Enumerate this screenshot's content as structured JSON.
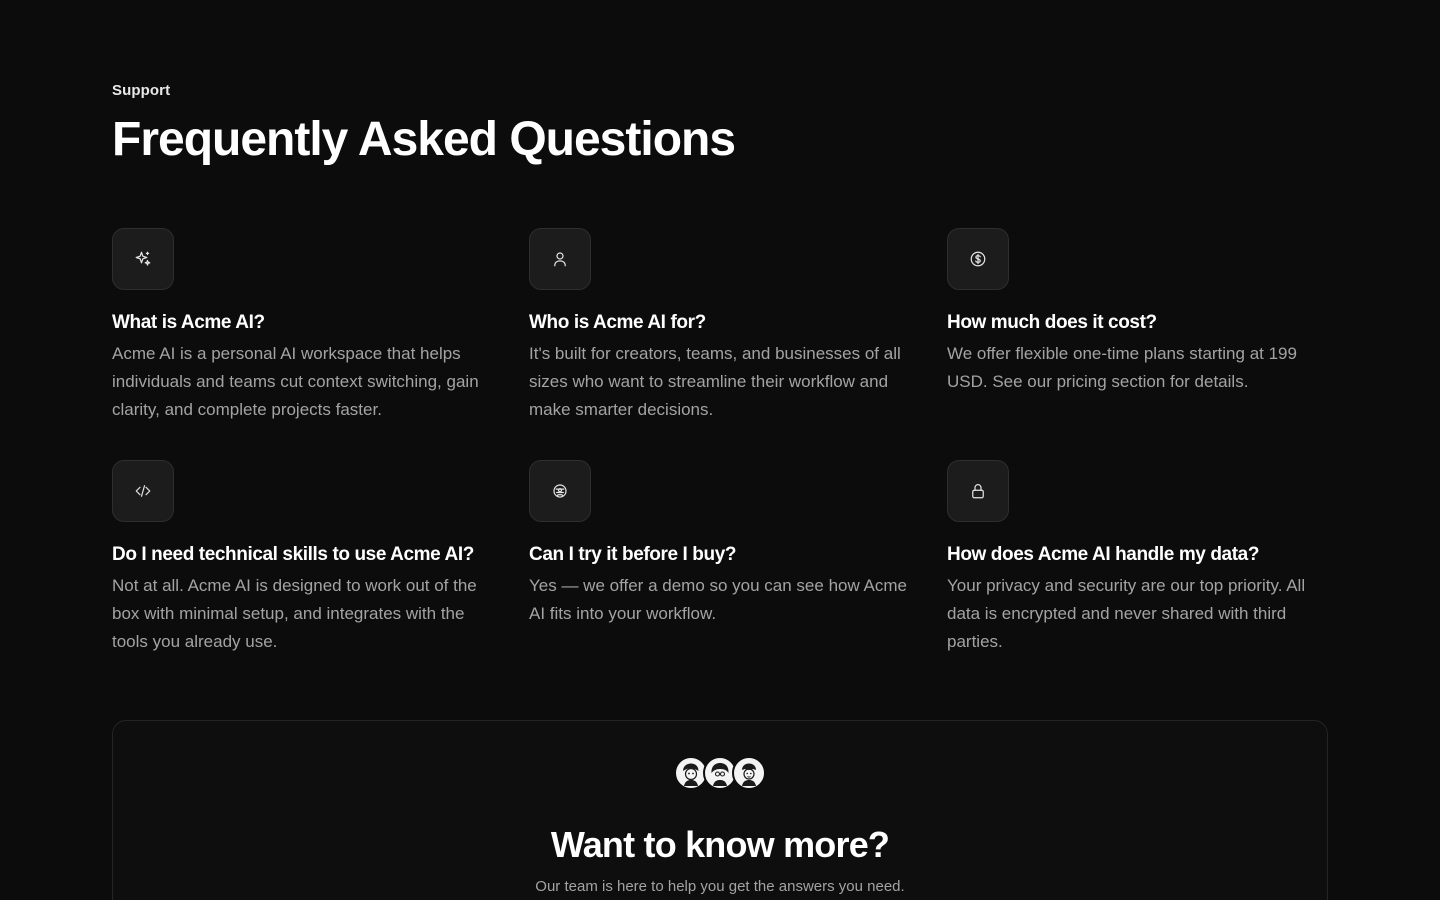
{
  "header": {
    "eyebrow": "Support",
    "title": "Frequently Asked Questions"
  },
  "faqs": [
    {
      "icon": "sparkles-icon",
      "question": "What is Acme AI?",
      "answer": "Acme AI is a personal AI workspace that helps individuals and teams cut context switching, gain clarity, and complete projects faster."
    },
    {
      "icon": "user-icon",
      "question": "Who is Acme AI for?",
      "answer": "It's built for creators, teams, and businesses of all sizes who want to streamline their workflow and make smarter decisions."
    },
    {
      "icon": "dollar-circle-icon",
      "question": "How much does it cost?",
      "answer": "We offer flexible one-time plans starting at 199 USD. See our pricing section for details."
    },
    {
      "icon": "code-icon",
      "question": "Do I need technical skills to use Acme AI?",
      "answer": "Not at all. Acme AI is designed to work out of the box with minimal setup, and integrates with the tools you already use."
    },
    {
      "icon": "user-circle-icon",
      "question": "Can I try it before I buy?",
      "answer": "Yes — we offer a demo so you can see how Acme AI fits into your workflow."
    },
    {
      "icon": "lock-icon",
      "question": "How does Acme AI handle my data?",
      "answer": "Your privacy and security are our top priority. All data is encrypted and never shared with third parties."
    }
  ],
  "cta": {
    "title": "Want to know more?",
    "subtitle": "Our team is here to help you get the answers you need.",
    "avatars": [
      "avatar-1",
      "avatar-2",
      "avatar-3"
    ]
  },
  "colors": {
    "background": "#0c0c0c",
    "icon_box": "#1c1c1c",
    "muted_text": "#a3a3a3"
  }
}
